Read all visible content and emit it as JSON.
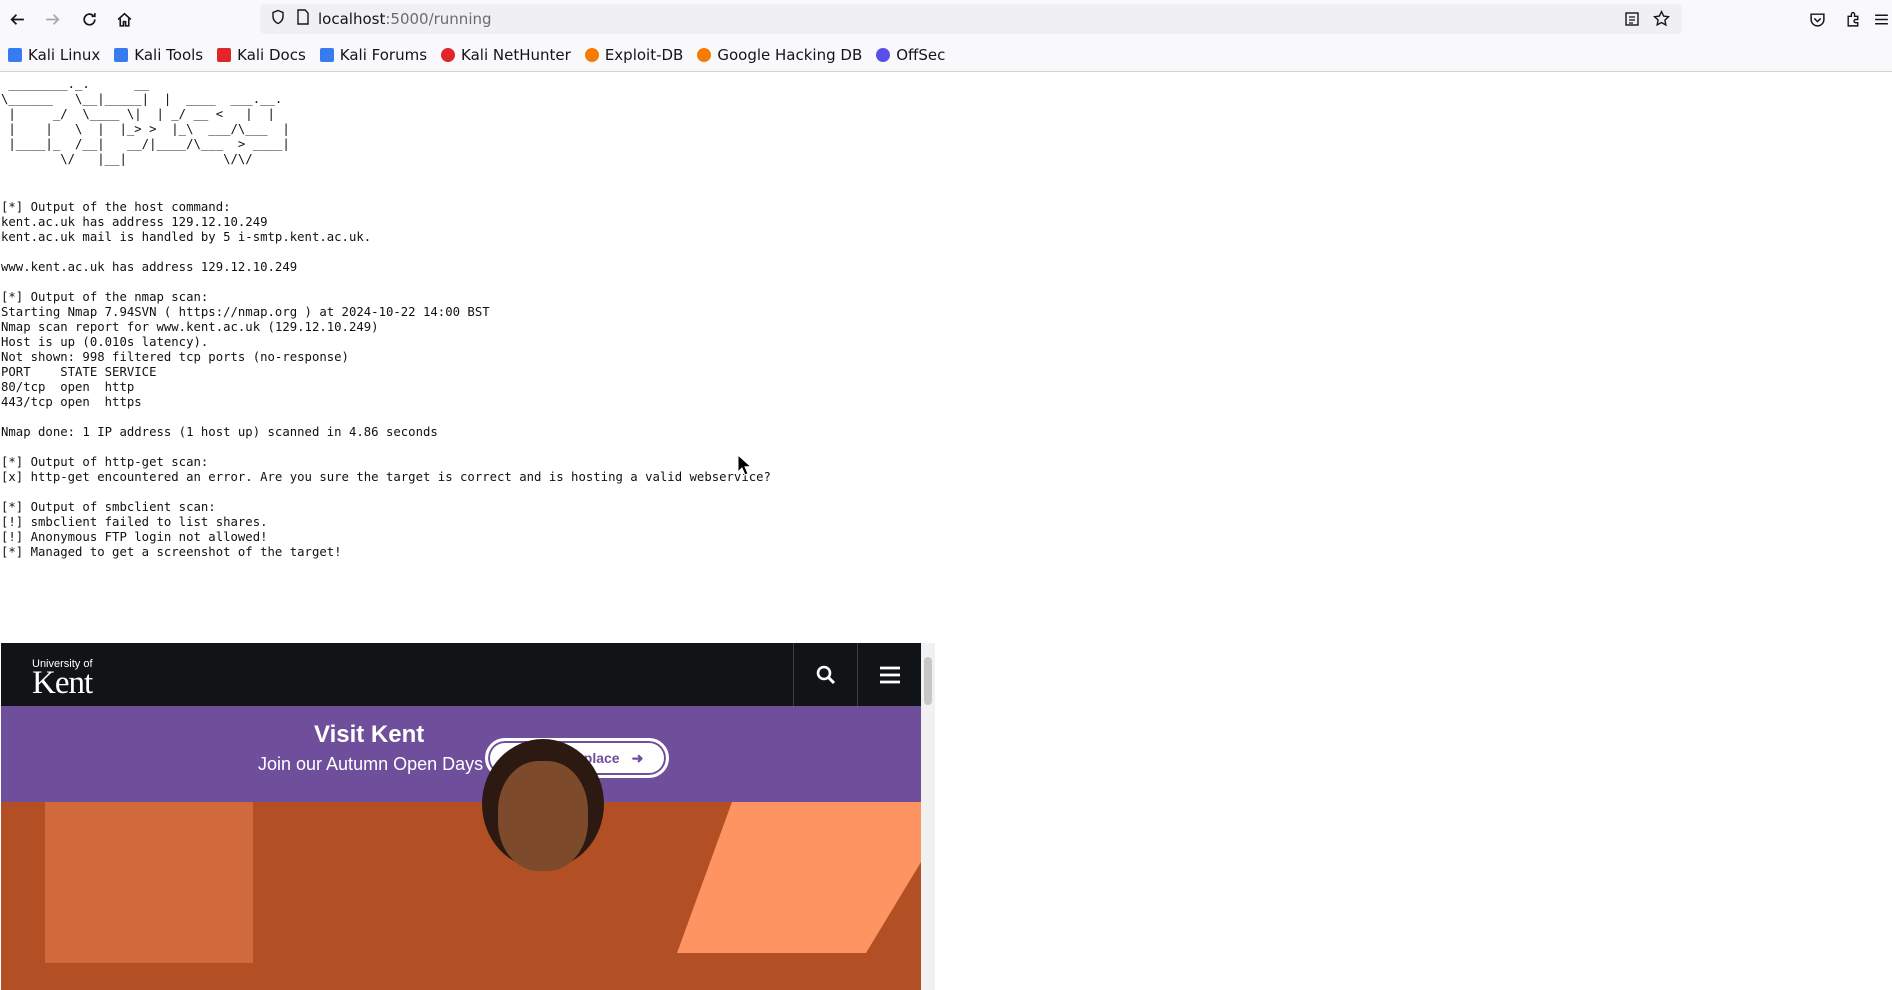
{
  "browser": {
    "url_host": "localhost",
    "url_path": ":5000/running",
    "bookmarks": [
      {
        "label": "Kali Linux",
        "color": "#367bf0"
      },
      {
        "label": "Kali Tools",
        "color": "#367bf0"
      },
      {
        "label": "Kali Docs",
        "color": "#e0252b"
      },
      {
        "label": "Kali Forums",
        "color": "#367bf0"
      },
      {
        "label": "Kali NetHunter",
        "color": "#e0252b"
      },
      {
        "label": "Exploit-DB",
        "color": "#f57c00"
      },
      {
        "label": "Google Hacking DB",
        "color": "#f57c00"
      },
      {
        "label": "OffSec",
        "color": "#5b4fe9"
      }
    ]
  },
  "terminal": {
    "banner": " ________._.      __ \n\\______   \\__|_____|  |  ____  ___.__.\n |     _/  \\____ \\|  | _/ __ <   |  |\n |    |   \\  |  |_> >  |_\\  ___/\\___  |\n |____|_  /__|   __/|____/\\___  > ____|\n        \\/   |__|             \\/\\/",
    "lines": [
      "[*] Output of the host command:",
      "kent.ac.uk has address 129.12.10.249",
      "kent.ac.uk mail is handled by 5 i-smtp.kent.ac.uk.",
      "",
      "www.kent.ac.uk has address 129.12.10.249",
      "",
      "[*] Output of the nmap scan:",
      "Starting Nmap 7.94SVN ( https://nmap.org ) at 2024-10-22 14:00 BST",
      "Nmap scan report for www.kent.ac.uk (129.12.10.249)",
      "Host is up (0.010s latency).",
      "Not shown: 998 filtered tcp ports (no-response)",
      "PORT    STATE SERVICE",
      "80/tcp  open  http",
      "443/tcp open  https",
      "",
      "Nmap done: 1 IP address (1 host up) scanned in 4.86 seconds",
      "",
      "[*] Output of http-get scan:",
      "[x] http-get encountered an error. Are you sure the target is correct and is hosting a valid webservice?",
      "",
      "[*] Output of smbclient scan:",
      "[!] smbclient failed to list shares.",
      "[!] Anonymous FTP login not allowed!",
      "[*] Managed to get a screenshot of the target!"
    ]
  },
  "screenshot": {
    "logo_small": "University of",
    "logo_big": "Kent",
    "banner_title": "Visit Kent",
    "banner_sub": "Join our Autumn Open Days",
    "book_button": "Book your place",
    "colors": {
      "nav": "#111417",
      "banner": "#6f4f9c",
      "hero": "#b24f24",
      "accent": "#fd9462"
    }
  }
}
